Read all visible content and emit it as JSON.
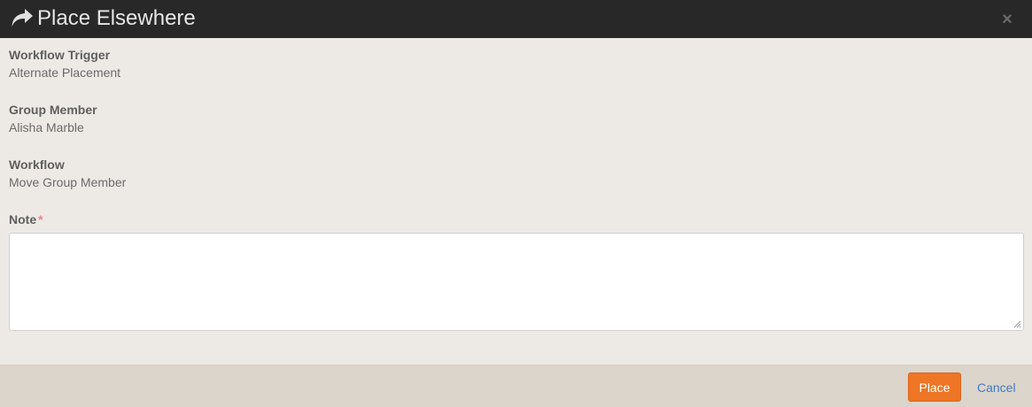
{
  "dialog": {
    "title": "Place Elsewhere",
    "title_icon": "share-icon",
    "close_icon": "close-icon",
    "close_glyph": "×"
  },
  "fields": {
    "workflow_trigger": {
      "label": "Workflow Trigger",
      "value": "Alternate Placement"
    },
    "group_member": {
      "label": "Group Member",
      "value": "Alisha Marble"
    },
    "workflow": {
      "label": "Workflow",
      "value": "Move Group Member"
    },
    "note": {
      "label": "Note",
      "required_mark": "*",
      "value": ""
    }
  },
  "footer": {
    "place_label": "Place",
    "cancel_label": "Cancel"
  },
  "colors": {
    "header_bg": "#282828",
    "body_bg": "#edeae6",
    "footer_bg": "#dcd5cc",
    "primary_button": "#ee7624",
    "link": "#3a7fc1",
    "required": "#e9838a"
  }
}
